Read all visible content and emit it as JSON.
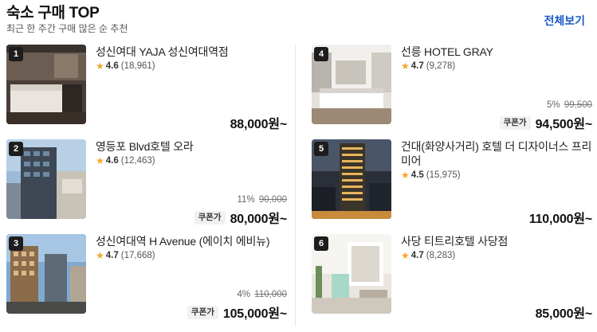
{
  "header": {
    "title": "숙소 구매 TOP",
    "subtitle": "최근 한 주간 구매 많은 순 추천",
    "view_all": "전체보기"
  },
  "hotels": [
    {
      "rank": "1",
      "name": "성신여대 YAJA 성신여대역점",
      "rating": "4.6",
      "reviews": "(18,961)",
      "discount_pct": "",
      "original_price": "",
      "coupon": "",
      "price": "88,000원~"
    },
    {
      "rank": "2",
      "name": "영등포 Blvd호텔 오라",
      "rating": "4.6",
      "reviews": "(12,463)",
      "discount_pct": "11%",
      "original_price": "90,000",
      "coupon": "쿠폰가",
      "price": "80,000원~"
    },
    {
      "rank": "3",
      "name": "성신여대역 H Avenue (에이치 에비뉴)",
      "rating": "4.7",
      "reviews": "(17,668)",
      "discount_pct": "4%",
      "original_price": "110,000",
      "coupon": "쿠폰가",
      "price": "105,000원~"
    },
    {
      "rank": "4",
      "name": "선릉 HOTEL GRAY",
      "rating": "4.7",
      "reviews": "(9,278)",
      "discount_pct": "5%",
      "original_price": "99,500",
      "coupon": "쿠폰가",
      "price": "94,500원~"
    },
    {
      "rank": "5",
      "name": "건대(화양사거리) 호텔 더 디자이너스 프리미어",
      "rating": "4.5",
      "reviews": "(15,975)",
      "discount_pct": "",
      "original_price": "",
      "coupon": "",
      "price": "110,000원~"
    },
    {
      "rank": "6",
      "name": "사당 티트리호텔 사당점",
      "rating": "4.7",
      "reviews": "(8,283)",
      "discount_pct": "",
      "original_price": "",
      "coupon": "",
      "price": "85,000원~"
    }
  ],
  "icons": {
    "rating": "star-icon"
  },
  "colors": {
    "accent_link": "#1a5ac8",
    "star": "#f5a623",
    "rank_badge": "#1d1d1d"
  }
}
